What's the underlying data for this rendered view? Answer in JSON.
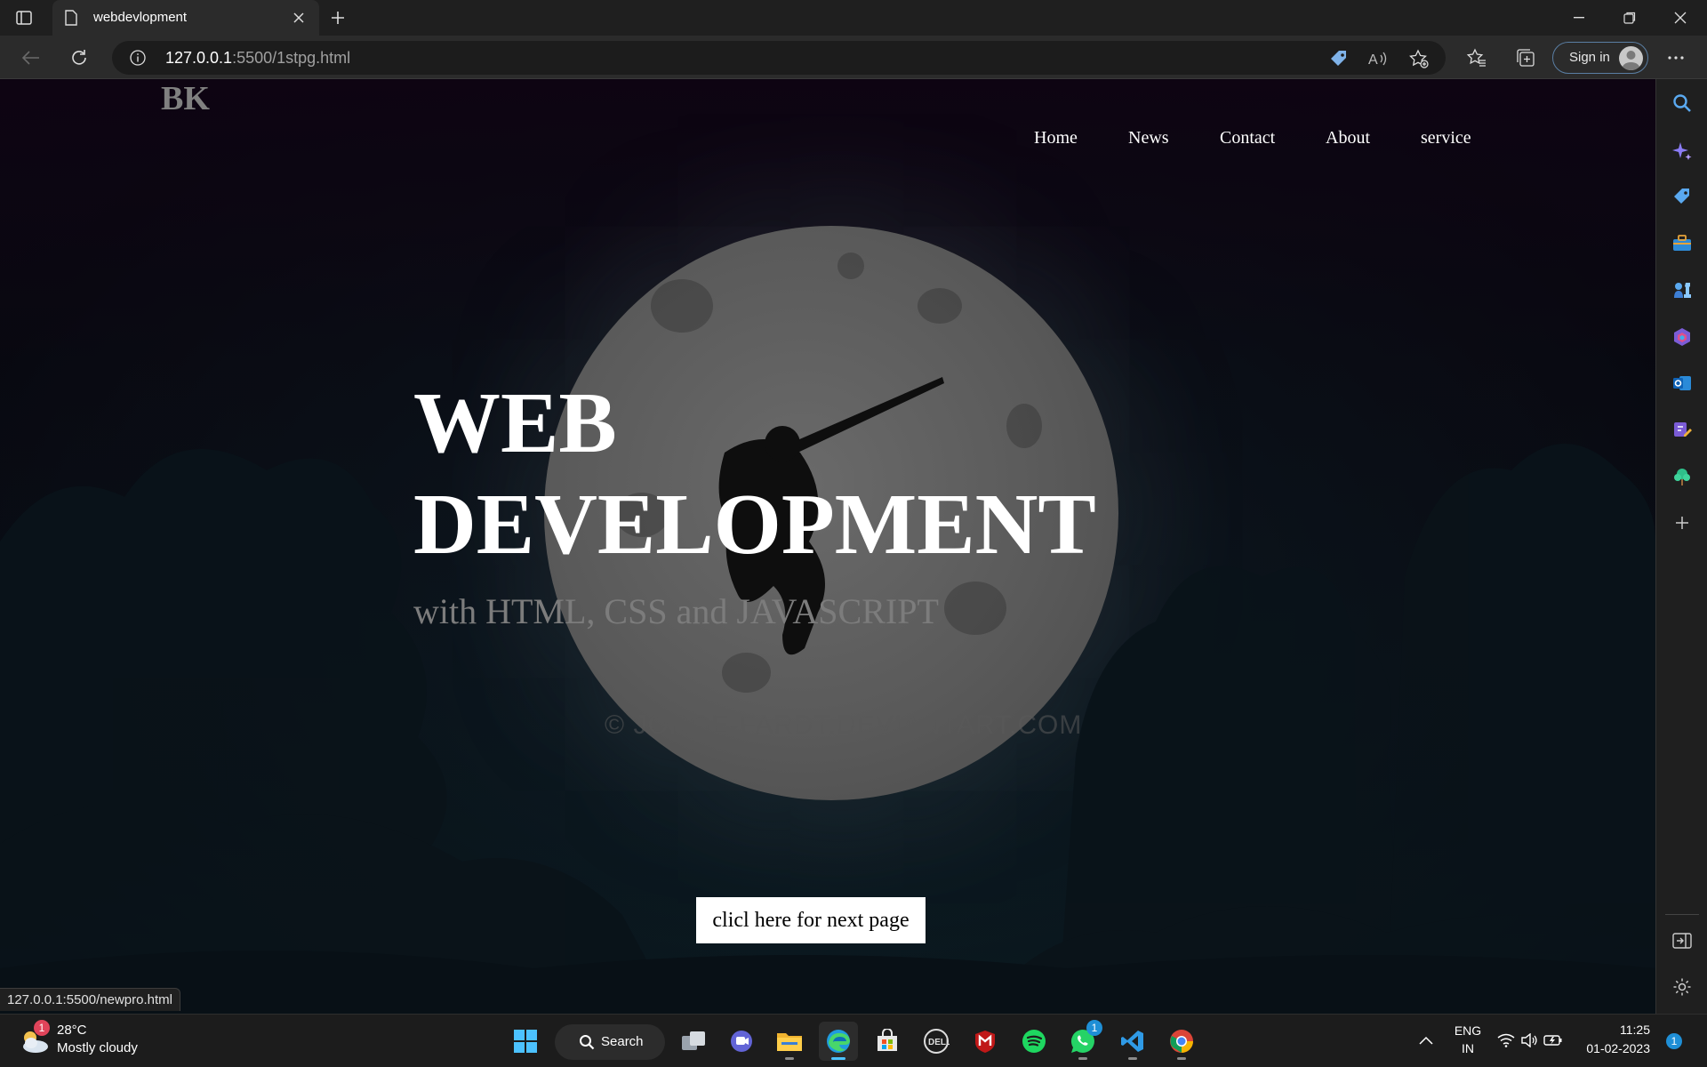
{
  "browser": {
    "tab_title": "webdevlopment",
    "url_host": "127.0.0.1",
    "url_path": ":5500/1stpg.html",
    "signin_label": "Sign in"
  },
  "page": {
    "brand": "BK",
    "nav": [
      "Home",
      "News",
      "Contact",
      "About",
      "service"
    ],
    "hero_line1": "WEB",
    "hero_line2": "DEVELOPMENT",
    "hero_subtitle": "with HTML, CSS and JAVASCRIPT",
    "watermark": "© JORGE-FARDT.DEVIANTART.COM",
    "cta_label": "clicl here for next page",
    "status_url": "127.0.0.1:5500/newpro.html"
  },
  "taskbar": {
    "weather_temp": "28°C",
    "weather_desc": "Mostly cloudy",
    "weather_badge": "1",
    "search_label": "Search",
    "whatsapp_badge": "1",
    "lang_line1": "ENG",
    "lang_line2": "IN",
    "time": "11:25",
    "date": "01-02-2023",
    "notif_count": "1"
  },
  "colors": {
    "accent": "#4cc2ff",
    "hero_text": "#ffffff",
    "subtitle": "#7c7c7c",
    "brand": "#808080"
  }
}
